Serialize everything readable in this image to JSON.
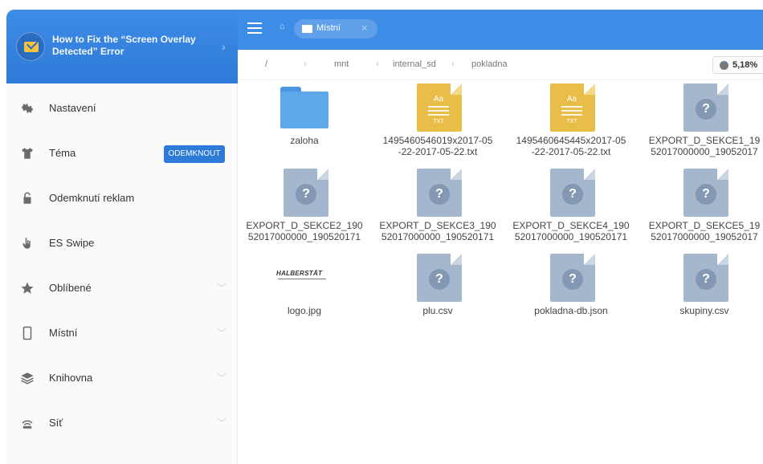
{
  "drawer": {
    "ad_title": "How to Fix the “Screen Overlay Detected” Error",
    "menu": [
      {
        "label": "Nastavení",
        "icon": "gear-icon"
      },
      {
        "label": "Téma",
        "icon": "shirt-icon",
        "badge": "ODEMKNOUT"
      },
      {
        "label": "Odemknutí reklam",
        "icon": "lock-icon"
      },
      {
        "label": "ES Swipe",
        "icon": "swipe-hand-icon"
      },
      {
        "label": "Oblíbené",
        "icon": "star-icon",
        "expandable": true
      },
      {
        "label": "Místní",
        "icon": "phone-icon",
        "expandable": true
      },
      {
        "label": "Knihovna",
        "icon": "layers-icon",
        "expandable": true
      },
      {
        "label": "Síť",
        "icon": "network-icon",
        "expandable": true
      }
    ]
  },
  "appbar": {
    "tab_label": "Místní",
    "accent": "#3d8ce6"
  },
  "path": {
    "crumbs": [
      "/",
      "mnt",
      "internal_sd",
      "pokladna"
    ],
    "storage_used": "5,18%"
  },
  "files": [
    {
      "name": "zaloha",
      "type": "folder"
    },
    {
      "name": "1495460546019x2017-05\n-22-2017-05-22.txt",
      "name_line1": "1495460546019x2017-05",
      "name_line2": "-22-2017-05-22.txt",
      "type": "txt",
      "glyph": "Aa",
      "ext": "TXT"
    },
    {
      "name_line1": "1495460645445x2017-05",
      "name_line2": "-22-2017-05-22.txt",
      "type": "txt",
      "glyph": "Aa",
      "ext": "TXT"
    },
    {
      "name_line1": "EXPORT_D_SEKCE1_19",
      "name_line2": "52017000000_19052017",
      "type": "unknown"
    },
    {
      "name_line1": "EXPORT_D_SEKCE2_190",
      "name_line2": "52017000000_190520171",
      "type": "unknown"
    },
    {
      "name_line1": "EXPORT_D_SEKCE3_190",
      "name_line2": "52017000000_190520171",
      "type": "unknown"
    },
    {
      "name_line1": "EXPORT_D_SEKCE4_190",
      "name_line2": "52017000000_190520171",
      "type": "unknown"
    },
    {
      "name_line1": "EXPORT_D_SEKCE5_19",
      "name_line2": "52017000000_19052017",
      "type": "unknown"
    },
    {
      "name_line1": "logo.jpg",
      "type": "image",
      "logo_text": "HALBERSTÄT"
    },
    {
      "name_line1": "plu.csv",
      "type": "unknown"
    },
    {
      "name_line1": "pokladna-db.json",
      "type": "unknown"
    },
    {
      "name_line1": "skupiny.csv",
      "type": "unknown"
    }
  ]
}
